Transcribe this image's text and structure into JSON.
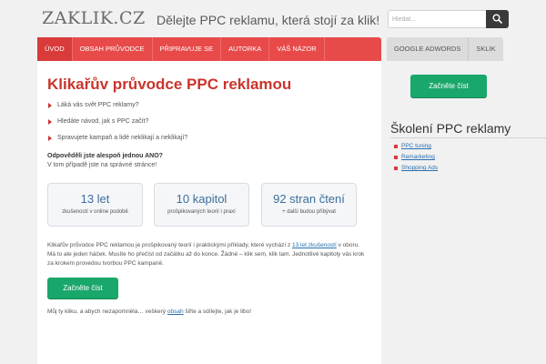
{
  "header": {
    "logo": "ZAKLIK.CZ",
    "tagline": "Dělejte PPC reklamu, která stojí za klik!",
    "search_placeholder": "Hledat..."
  },
  "nav": {
    "items": [
      {
        "label": "Úvod",
        "active": true
      },
      {
        "label": "Obsah průvodce"
      },
      {
        "label": "Připravuje se"
      },
      {
        "label": "Autorka"
      },
      {
        "label": "Váš názor"
      }
    ],
    "right_items": [
      {
        "label": "Google AdWords"
      },
      {
        "label": "Sklik"
      }
    ]
  },
  "main": {
    "title": "Klikařův průvodce PPC reklamou",
    "bullets": [
      "Láká vás svět PPC reklamy?",
      "Hledáte návod, jak s PPC začít?",
      "Spravujete kampaň a lidé neklikají a neklikají?"
    ],
    "question_bold": "Odpověděli jste alespoň jednou ANO?",
    "question_text": "V tom případě jste na správné stránce!",
    "stats": [
      {
        "big": "13 let",
        "small": "zkušeností v online podobě"
      },
      {
        "big": "10 kapitol",
        "small": "prošpikovaných teorií i praxí"
      },
      {
        "big": "92 stran čtení",
        "small": "+ další budou přibývat"
      }
    ],
    "para_part1": "Klikařův průvodce PPC reklamou je prošpikovaný teorií i praktickými příklady, které vychází z ",
    "para_link": "13 let zkušeností",
    "para_part2": " v oboru. Má to ale jeden háček. Musíte ho přečíst od začátku až do konce. Žádné – klik sem, klik tam. Jednotlivé kapitoly vás krok za krokem provedou tvorbou PPC kampaně.",
    "cta": "Začněte číst",
    "footer_part1": "Můj ty kliku, a abych nezapomněla… veškerý ",
    "footer_link": "obsah",
    "footer_part2": " šiřte a sdílejte, jak je libo!"
  },
  "sidebar": {
    "cta": "Začněte číst",
    "title": "Školení PPC reklamy",
    "links": [
      "PPC tuning",
      "Remarketing",
      "Shopping Ads"
    ]
  },
  "colors": {
    "accent_red": "#e84a4a",
    "title_red": "#c9352c",
    "cta_green": "#1aa76b",
    "stat_blue": "#3d6f9c",
    "link_blue": "#2b6fb0"
  }
}
